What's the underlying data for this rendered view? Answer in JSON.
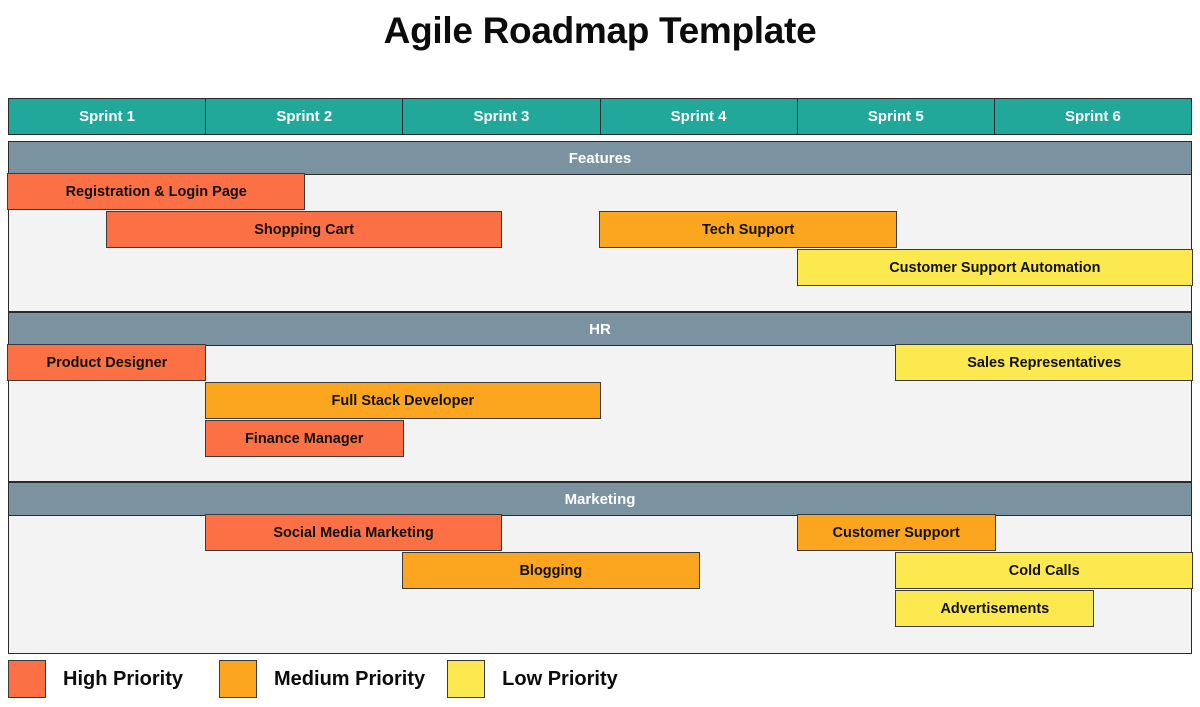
{
  "title": "Agile Roadmap Template",
  "colors": {
    "sprint_header": "#22a89a",
    "section_band": "#7b93a0",
    "section_body": "#f3f3f3",
    "high_priority": "#fb7044",
    "medium_priority": "#fca51f",
    "low_priority": "#fce94f",
    "border": "#2a2a2a",
    "text_dark": "#111111",
    "text_light": "#ffffff"
  },
  "timeline": {
    "columns": [
      "Sprint 1",
      "Sprint 2",
      "Sprint 3",
      "Sprint 4",
      "Sprint 5",
      "Sprint 6"
    ],
    "column_count": 6
  },
  "legend": {
    "items": [
      {
        "label": "High Priority",
        "color": "#fb7044",
        "key": "high"
      },
      {
        "label": "Medium Priority",
        "color": "#fca51f",
        "key": "medium"
      },
      {
        "label": "Low Priority",
        "color": "#fce94f",
        "key": "low"
      }
    ]
  },
  "sections": [
    {
      "name": "Features",
      "tasks": [
        {
          "label": "Registration & Login Page",
          "priority": "high",
          "color": "#fb7044",
          "row": 0,
          "start": 0.0,
          "end": 1.5
        },
        {
          "label": "Shopping Cart",
          "priority": "high",
          "color": "#fb7044",
          "row": 1,
          "start": 0.5,
          "end": 2.5
        },
        {
          "label": "Tech Support",
          "priority": "medium",
          "color": "#fca51f",
          "row": 1,
          "start": 3.0,
          "end": 4.5
        },
        {
          "label": "Customer Support Automation",
          "priority": "low",
          "color": "#fce94f",
          "row": 2,
          "start": 4.0,
          "end": 6.0
        }
      ]
    },
    {
      "name": "HR",
      "tasks": [
        {
          "label": "Product Designer",
          "priority": "high",
          "color": "#fb7044",
          "row": 0,
          "start": 0.0,
          "end": 1.0
        },
        {
          "label": "Sales Representatives",
          "priority": "low",
          "color": "#fce94f",
          "row": 0,
          "start": 4.5,
          "end": 6.0
        },
        {
          "label": "Full Stack Developer",
          "priority": "medium",
          "color": "#fca51f",
          "row": 1,
          "start": 1.0,
          "end": 3.0
        },
        {
          "label": "Finance Manager",
          "priority": "high",
          "color": "#fb7044",
          "row": 2,
          "start": 1.0,
          "end": 2.0
        }
      ]
    },
    {
      "name": "Marketing",
      "tasks": [
        {
          "label": "Social Media Marketing",
          "priority": "high",
          "color": "#fb7044",
          "row": 0,
          "start": 1.0,
          "end": 2.5
        },
        {
          "label": "Customer Support",
          "priority": "medium",
          "color": "#fca51f",
          "row": 0,
          "start": 4.0,
          "end": 5.0
        },
        {
          "label": "Blogging",
          "priority": "medium",
          "color": "#fca51f",
          "row": 1,
          "start": 2.0,
          "end": 3.5
        },
        {
          "label": "Cold Calls",
          "priority": "low",
          "color": "#fce94f",
          "row": 1,
          "start": 4.5,
          "end": 6.0
        },
        {
          "label": "Advertisements",
          "priority": "low",
          "color": "#fce94f",
          "row": 2,
          "start": 4.5,
          "end": 5.5
        }
      ]
    }
  ],
  "chart_data": {
    "type": "bar",
    "subtype": "gantt-roadmap",
    "title": "Agile Roadmap Template",
    "xlabel": "",
    "ylabel": "",
    "categories": [
      "Sprint 1",
      "Sprint 2",
      "Sprint 3",
      "Sprint 4",
      "Sprint 5",
      "Sprint 6"
    ],
    "xlim": [
      0,
      6
    ],
    "grid": false,
    "legend_position": "bottom-left",
    "legend_entries": [
      "High Priority",
      "Medium Priority",
      "Low Priority"
    ],
    "swimlanes": [
      "Features",
      "HR",
      "Marketing"
    ],
    "series": [
      {
        "name": "Registration & Login Page",
        "swimlane": "Features",
        "priority": "High Priority",
        "start_sprint": 1.0,
        "end_sprint": 2.5,
        "duration_sprints": 1.5
      },
      {
        "name": "Shopping Cart",
        "swimlane": "Features",
        "priority": "High Priority",
        "start_sprint": 1.5,
        "end_sprint": 3.5,
        "duration_sprints": 2.0
      },
      {
        "name": "Tech Support",
        "swimlane": "Features",
        "priority": "Medium Priority",
        "start_sprint": 4.0,
        "end_sprint": 5.5,
        "duration_sprints": 1.5
      },
      {
        "name": "Customer Support Automation",
        "swimlane": "Features",
        "priority": "Low Priority",
        "start_sprint": 5.0,
        "end_sprint": 7.0,
        "duration_sprints": 2.0
      },
      {
        "name": "Product Designer",
        "swimlane": "HR",
        "priority": "High Priority",
        "start_sprint": 1.0,
        "end_sprint": 2.0,
        "duration_sprints": 1.0
      },
      {
        "name": "Sales Representatives",
        "swimlane": "HR",
        "priority": "Low Priority",
        "start_sprint": 5.5,
        "end_sprint": 7.0,
        "duration_sprints": 1.5
      },
      {
        "name": "Full Stack Developer",
        "swimlane": "HR",
        "priority": "Medium Priority",
        "start_sprint": 2.0,
        "end_sprint": 4.0,
        "duration_sprints": 2.0
      },
      {
        "name": "Finance Manager",
        "swimlane": "HR",
        "priority": "High Priority",
        "start_sprint": 2.0,
        "end_sprint": 3.0,
        "duration_sprints": 1.0
      },
      {
        "name": "Social Media Marketing",
        "swimlane": "Marketing",
        "priority": "High Priority",
        "start_sprint": 2.0,
        "end_sprint": 3.5,
        "duration_sprints": 1.5
      },
      {
        "name": "Customer Support",
        "swimlane": "Marketing",
        "priority": "Medium Priority",
        "start_sprint": 5.0,
        "end_sprint": 6.0,
        "duration_sprints": 1.0
      },
      {
        "name": "Blogging",
        "swimlane": "Marketing",
        "priority": "Medium Priority",
        "start_sprint": 3.0,
        "end_sprint": 4.5,
        "duration_sprints": 1.5
      },
      {
        "name": "Cold Calls",
        "swimlane": "Marketing",
        "priority": "Low Priority",
        "start_sprint": 5.5,
        "end_sprint": 7.0,
        "duration_sprints": 1.5
      },
      {
        "name": "Advertisements",
        "swimlane": "Marketing",
        "priority": "Low Priority",
        "start_sprint": 5.5,
        "end_sprint": 6.5,
        "duration_sprints": 1.0
      }
    ]
  }
}
